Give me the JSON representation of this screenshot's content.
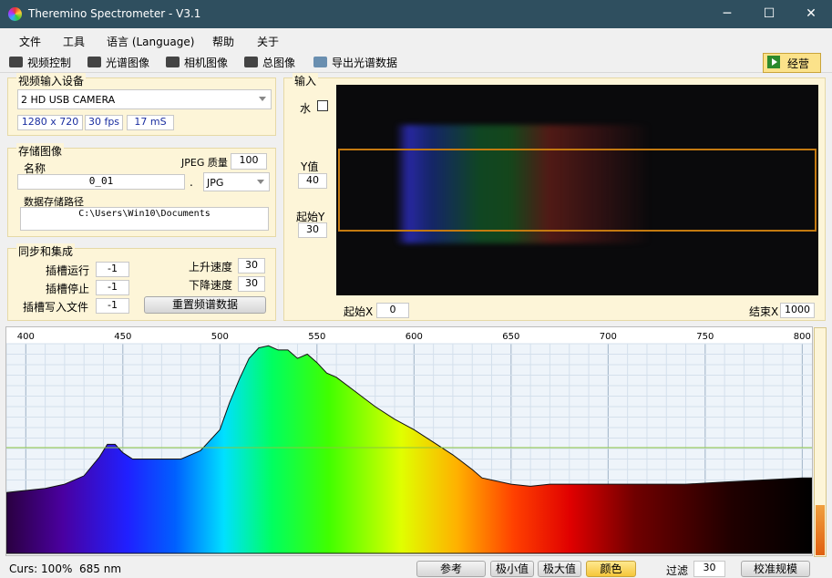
{
  "window": {
    "title": "Theremino Spectrometer - V3.1",
    "controls": {
      "minimize": "─",
      "maximize": "☐",
      "close": "✕"
    }
  },
  "menu": [
    "文件",
    "工具",
    "语言 (Language)",
    "帮助",
    "关于"
  ],
  "toolbar": {
    "video_control": "视频控制",
    "spectrum_image": "光谱图像",
    "camera_image": "相机图像",
    "total_image": "总图像",
    "export": "导出光谱数据",
    "run": "经营"
  },
  "video_input": {
    "title": "视频输入设备",
    "device": "2 HD USB CAMERA",
    "resolution": "1280 x 720",
    "fps": "30 fps",
    "exposure": "17 mS"
  },
  "storage": {
    "title": "存储图像",
    "name_label": "名称",
    "jpeg_quality_label": "JPEG 质量",
    "jpeg_quality": "100",
    "name_value": "0_01",
    "dot": ".",
    "format": "JPG",
    "path_label": "数据存储路径",
    "path": "C:\\Users\\Win10\\Documents"
  },
  "sync": {
    "title": "同步和集成",
    "slot_run_label": "插槽运行",
    "slot_run": "-1",
    "slot_stop_label": "插槽停止",
    "slot_stop": "-1",
    "slot_write_label": "插槽写入文件",
    "slot_write": "-1",
    "rise_speed_label": "上升速度",
    "rise_speed": "30",
    "fall_speed_label": "下降速度",
    "fall_speed": "30",
    "reset_button": "重置频谱数据"
  },
  "input": {
    "title": "输入",
    "flip_label": "水",
    "flip_checked": false,
    "y_label": "Y值",
    "y_value": "40",
    "start_y_label": "起始Y",
    "start_y": "30",
    "start_x_label": "起始X",
    "start_x": "0",
    "end_x_label": "结束X",
    "end_x": "1000"
  },
  "level_meter": {
    "fraction": 0.22
  },
  "chart_data": {
    "type": "area",
    "x_tick_labels": [
      "400",
      "450",
      "500",
      "550",
      "600",
      "650",
      "700",
      "750",
      "800"
    ],
    "xlim": [
      390,
      805
    ],
    "ylim": [
      0,
      100
    ],
    "grid": true,
    "x": [
      390,
      400,
      410,
      420,
      430,
      438,
      442,
      446,
      450,
      455,
      460,
      470,
      480,
      490,
      500,
      505,
      510,
      515,
      520,
      525,
      530,
      535,
      540,
      545,
      550,
      555,
      560,
      570,
      580,
      590,
      600,
      610,
      620,
      630,
      635,
      640,
      650,
      660,
      670,
      680,
      700,
      720,
      740,
      760,
      780,
      800,
      805
    ],
    "y": [
      29,
      30,
      31,
      33,
      37,
      46,
      52,
      52,
      48,
      45,
      45,
      45,
      45,
      49,
      59,
      72,
      83,
      93,
      98,
      99,
      97,
      97,
      93,
      95,
      91,
      86,
      84,
      77,
      70,
      64,
      59,
      53,
      47,
      40,
      36,
      35,
      33,
      32,
      33,
      33,
      33,
      33,
      33,
      34,
      35,
      36,
      36
    ],
    "curs_label": "Curs:",
    "curs_zoom": "100%",
    "curs_wavelength": "685 nm"
  },
  "status": {
    "reference": "参考",
    "min": "极小值",
    "max": "极大值",
    "color": "颜色",
    "filter_label": "过滤",
    "filter": "30",
    "calibrate": "校准规模"
  }
}
